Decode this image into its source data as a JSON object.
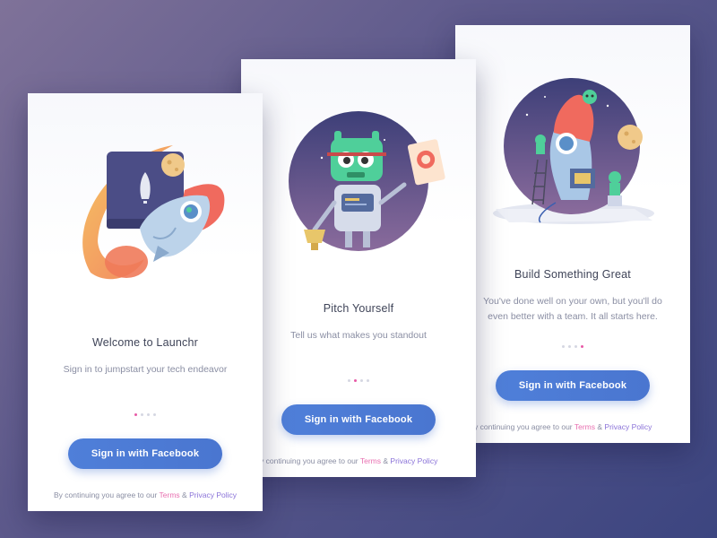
{
  "colors": {
    "accent_button": "#4a76d0",
    "dot_active": "#e85aa6",
    "terms_link": "#e86fb0",
    "privacy_link": "#8a72d8"
  },
  "cards": [
    {
      "title": "Welcome to Launchr",
      "subtitle_lines": [
        "Sign in to jumpstart your tech endeavor"
      ],
      "button_label": "Sign in with Facebook",
      "legal_prefix": "By continuing you agree to our",
      "terms_label": "Terms",
      "amp": "&",
      "privacy_label": "Privacy Policy",
      "active_dot": 1,
      "illustration": "rocket-launch-icon"
    },
    {
      "title": "Pitch Yourself",
      "subtitle_lines": [
        "Tell us what makes you standout"
      ],
      "button_label": "Sign in with Facebook",
      "legal_prefix": "y continuing you agree to our",
      "terms_label": "Terms",
      "amp": "&",
      "privacy_label": "Privacy Policy",
      "active_dot": 2,
      "illustration": "robot-with-trophy-icon"
    },
    {
      "title": "Build Something Great",
      "subtitle_lines": [
        "You've done well on your own, but you'll do",
        "even better with a team. It all starts here."
      ],
      "button_label": "Sign in with Facebook",
      "legal_prefix": "y continuing you agree to our",
      "terms_label": "Terms",
      "amp": "&",
      "privacy_label": "Privacy Policy",
      "active_dot": 4,
      "illustration": "rocket-construction-team-icon"
    }
  ]
}
